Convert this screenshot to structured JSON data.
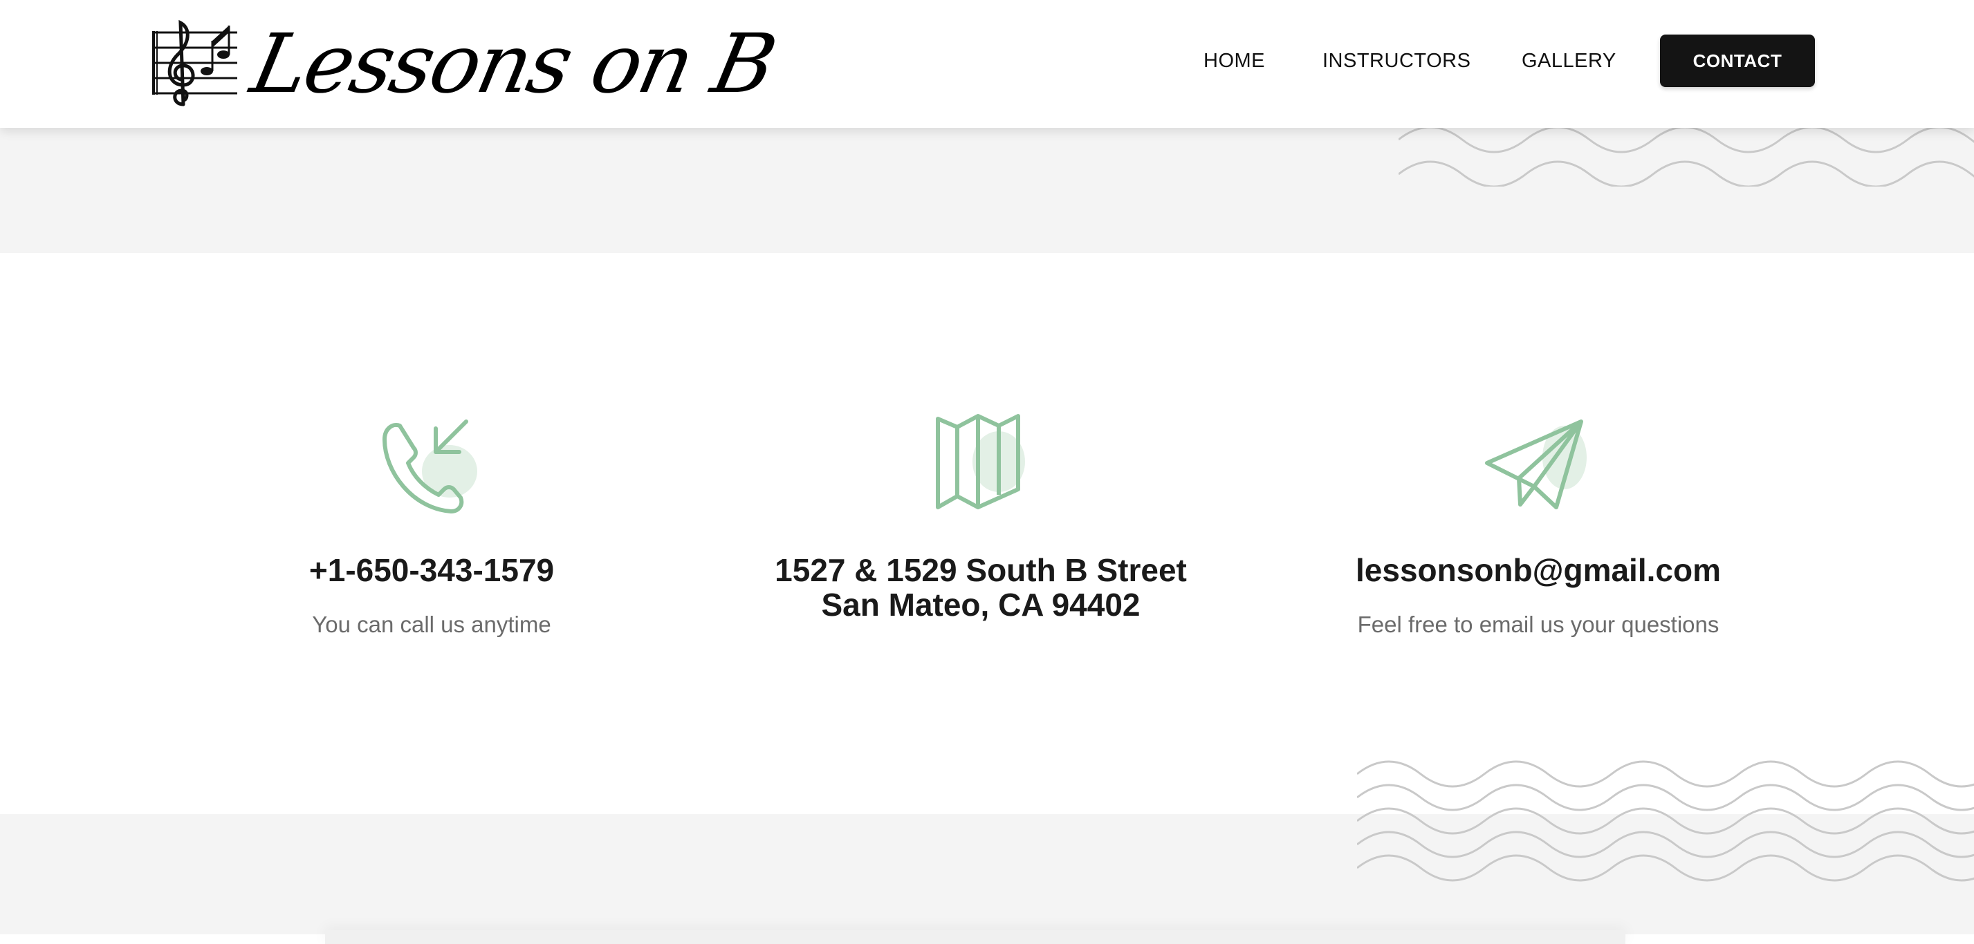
{
  "brand": {
    "name": "Lessons on B",
    "logo_icon": "music-staff-treble-clef-icon"
  },
  "nav": {
    "home": "HOME",
    "instructors": "INSTRUCTORS",
    "gallery": "GALLERY",
    "contact": "CONTACT"
  },
  "contact_info": {
    "phone": {
      "icon": "phone-incoming-icon",
      "title": "+1-650-343-1579",
      "subtitle": "You can call us anytime"
    },
    "address": {
      "icon": "map-icon",
      "line1": "1527 & 1529 South B Street",
      "line2": "San Mateo, CA 94402"
    },
    "email": {
      "icon": "paper-plane-icon",
      "title": "lessonsonb@gmail.com",
      "subtitle": "Feel free to email us your questions"
    }
  },
  "colors": {
    "accent_green": "#8fc39d",
    "accent_green_blob": "#e3f0e6",
    "button_bg": "#141414",
    "band_grey": "#f4f4f4",
    "wave_grey": "#c9c9c9"
  }
}
